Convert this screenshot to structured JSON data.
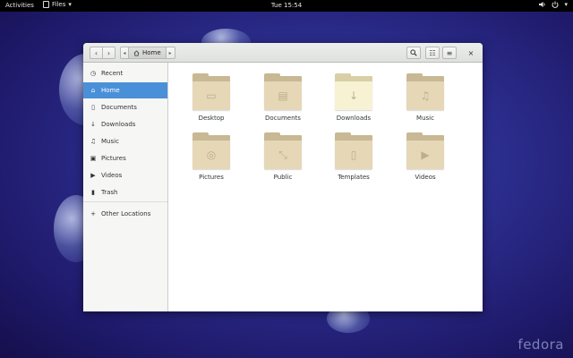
{
  "topbar": {
    "activities": "Activities",
    "app_name": "Files",
    "app_menu_arrow": "▾",
    "clock": "Tue 15:54",
    "volume_icon": "speaker-icon",
    "power_icon": "power-icon",
    "tray_arrow": "▾"
  },
  "window": {
    "nav_back": "‹",
    "nav_forward": "›",
    "path_left": "◂",
    "path_right": "▸",
    "path_current": "Home",
    "search_icon": "🔍",
    "view_icon": "☷",
    "menu_icon": "≡",
    "close": "×"
  },
  "sidebar": {
    "items": [
      {
        "label": "Recent",
        "icon": "◷"
      },
      {
        "label": "Home",
        "icon": "⌂"
      },
      {
        "label": "Documents",
        "icon": "▯"
      },
      {
        "label": "Downloads",
        "icon": "↓"
      },
      {
        "label": "Music",
        "icon": "♫"
      },
      {
        "label": "Pictures",
        "icon": "▣"
      },
      {
        "label": "Videos",
        "icon": "▶"
      },
      {
        "label": "Trash",
        "icon": "▮"
      },
      {
        "label": "Other Locations",
        "icon": "+"
      }
    ]
  },
  "files": [
    {
      "label": "Desktop",
      "glyph": "▭"
    },
    {
      "label": "Documents",
      "glyph": "▤"
    },
    {
      "label": "Downloads",
      "glyph": "↓"
    },
    {
      "label": "Music",
      "glyph": "♫"
    },
    {
      "label": "Pictures",
      "glyph": "◎"
    },
    {
      "label": "Public",
      "glyph": "⤡"
    },
    {
      "label": "Templates",
      "glyph": "▯"
    },
    {
      "label": "Videos",
      "glyph": "▶"
    }
  ],
  "wallpaper": {
    "logo": "fedora"
  },
  "colors": {
    "accent": "#4a90d9",
    "folder": "#e6d7b7",
    "topbar": "#000000"
  }
}
